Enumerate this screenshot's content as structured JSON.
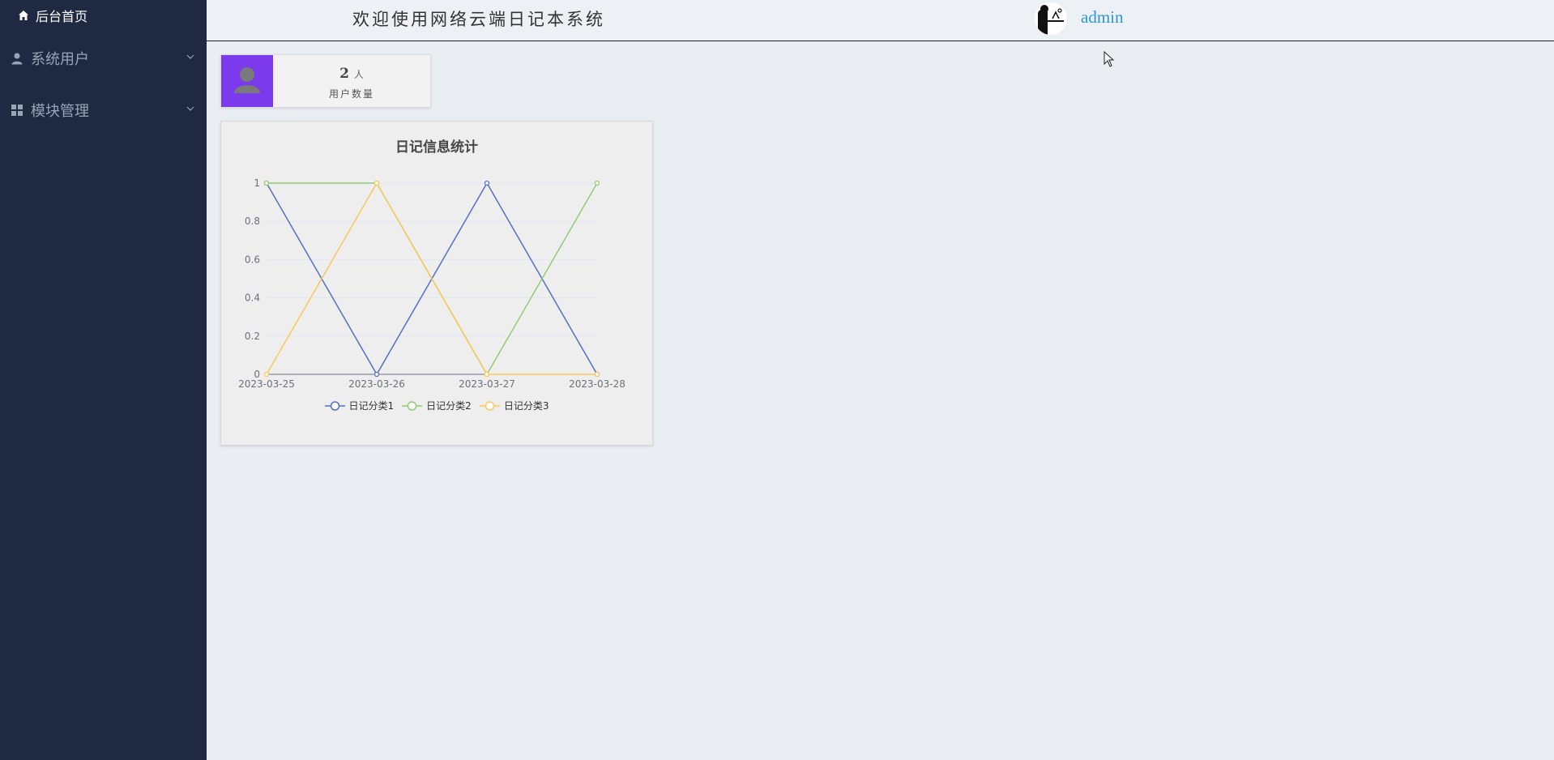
{
  "sidebar": {
    "home_label": "后台首页",
    "items": [
      {
        "label": "系统用户",
        "icon": "user-icon"
      },
      {
        "label": "模块管理",
        "icon": "grid-icon"
      }
    ]
  },
  "header": {
    "welcome": "欢迎使用网络云端日记本系统",
    "username": "admin"
  },
  "stat_card": {
    "count": "2",
    "unit": "人",
    "label": "用户数量",
    "color": "#7c3aed",
    "icon": "user-silhouette-icon"
  },
  "chart_data": {
    "type": "line",
    "title": "日记信息统计",
    "categories": [
      "2023-03-25",
      "2023-03-26",
      "2023-03-27",
      "2023-03-28"
    ],
    "ylim": [
      0,
      1
    ],
    "yticks": [
      "0",
      "0.2",
      "0.4",
      "0.6",
      "0.8",
      "1"
    ],
    "grid": true,
    "legend_position": "bottom",
    "series": [
      {
        "name": "日记分类1",
        "color": "#5470c6",
        "values": [
          1,
          0,
          1,
          0
        ]
      },
      {
        "name": "日记分类2",
        "color": "#91cc75",
        "values": [
          1,
          1,
          0,
          1
        ]
      },
      {
        "name": "日记分类3",
        "color": "#fac858",
        "values": [
          0,
          1,
          0,
          0
        ]
      }
    ]
  }
}
